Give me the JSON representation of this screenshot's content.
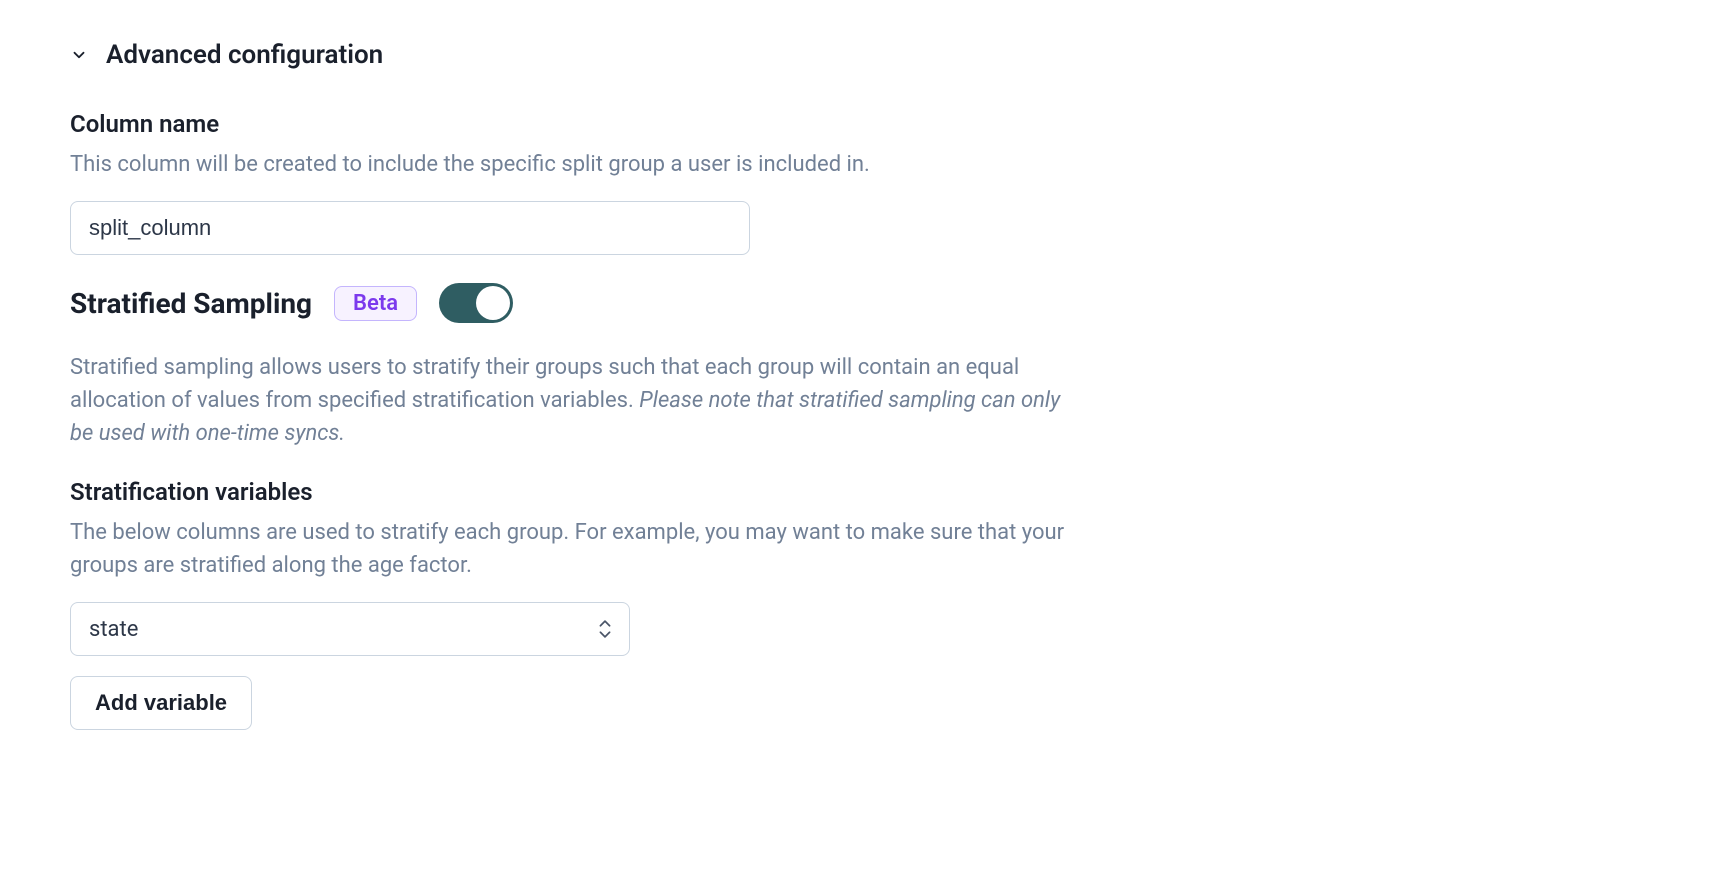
{
  "section": {
    "title": "Advanced configuration"
  },
  "columnName": {
    "label": "Column name",
    "help": "This column will be created to include the specific split group a user is included in.",
    "value": "split_column"
  },
  "stratified": {
    "heading": "Stratified Sampling",
    "badge": "Beta",
    "toggle_on": true,
    "description_plain": "Stratified sampling allows users to stratify their groups such that each group will contain an equal allocation of values from specified stratification variables. ",
    "description_italic": "Please note that stratified sampling can only be used with one-time syncs."
  },
  "stratVars": {
    "label": "Stratification variables",
    "help": "The below columns are used to stratify each group. For example, you may want to make sure that your groups are stratified along the age factor.",
    "selected": "state",
    "add_button": "Add variable"
  }
}
